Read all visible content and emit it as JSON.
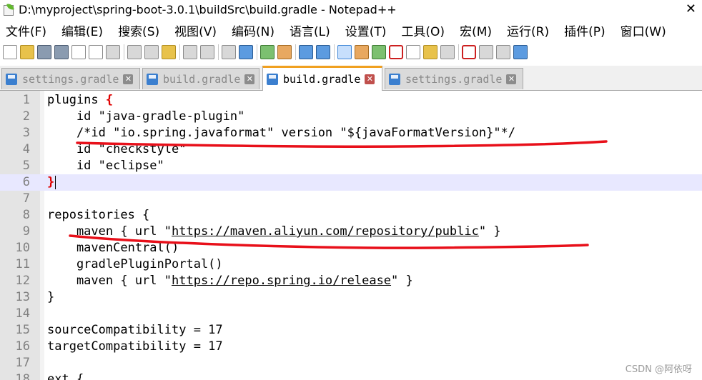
{
  "window": {
    "title": "D:\\myproject\\spring-boot-3.0.1\\buildSrc\\build.gradle - Notepad++",
    "close_glyph": "✕"
  },
  "menu": [
    "文件(F)",
    "编辑(E)",
    "搜索(S)",
    "视图(V)",
    "编码(N)",
    "语言(L)",
    "设置(T)",
    "工具(O)",
    "宏(M)",
    "运行(R)",
    "插件(P)",
    "窗口(W)"
  ],
  "toolbar": {
    "icons": [
      "new-file-icon",
      "open-file-icon",
      "save-icon",
      "save-all-icon",
      "close-icon",
      "close-all-icon",
      "print-icon",
      "cut-icon",
      "copy-icon",
      "paste-icon",
      "undo-icon",
      "redo-icon",
      "find-icon",
      "replace-icon",
      "zoom-in-icon",
      "zoom-out-icon",
      "sync-vertical-icon",
      "sync-horizontal-icon",
      "word-wrap-icon",
      "show-all-chars-icon",
      "indent-guide-icon",
      "document-map-icon",
      "function-list-icon",
      "folder-workspace-icon",
      "monitoring-icon",
      "record-macro-icon",
      "stop-record-icon",
      "play-macro-icon",
      "run-macro-multiple-icon"
    ]
  },
  "tabs": [
    {
      "label": "settings.gradle",
      "close": "✕",
      "active": false
    },
    {
      "label": "build.gradle",
      "close": "✕",
      "active": false
    },
    {
      "label": "build.gradle",
      "close": "✕",
      "active": true
    },
    {
      "label": "settings.gradle",
      "close": "✕",
      "active": false
    }
  ],
  "editor": {
    "lines": [
      {
        "num": "1",
        "segments": [
          {
            "text": "plugins "
          },
          {
            "text": "{",
            "style": "brace"
          }
        ]
      },
      {
        "num": "2",
        "segments": [
          {
            "text": "    id \"java-gradle-plugin\""
          }
        ]
      },
      {
        "num": "3",
        "segments": [
          {
            "text": "    /*id \"io.spring.javaformat\" version \"${javaFormatVersion}\"*/"
          }
        ]
      },
      {
        "num": "4",
        "segments": [
          {
            "text": "    id \"checkstyle\""
          }
        ]
      },
      {
        "num": "5",
        "segments": [
          {
            "text": "    id \"eclipse\""
          }
        ]
      },
      {
        "num": "6",
        "segments": [
          {
            "text": "}",
            "style": "brace"
          }
        ],
        "current": true
      },
      {
        "num": "7",
        "segments": []
      },
      {
        "num": "8",
        "segments": [
          {
            "text": "repositories {"
          }
        ]
      },
      {
        "num": "9",
        "segments": [
          {
            "text": "    maven { url \""
          },
          {
            "text": "https://maven.aliyun.com/repository/public",
            "style": "url"
          },
          {
            "text": "\" }"
          }
        ]
      },
      {
        "num": "10",
        "segments": [
          {
            "text": "    mavenCentral()"
          }
        ]
      },
      {
        "num": "11",
        "segments": [
          {
            "text": "    gradlePluginPortal()"
          }
        ]
      },
      {
        "num": "12",
        "segments": [
          {
            "text": "    maven { url \""
          },
          {
            "text": "https://repo.spring.io/release",
            "style": "url"
          },
          {
            "text": "\" }"
          }
        ]
      },
      {
        "num": "13",
        "segments": [
          {
            "text": "}"
          }
        ]
      },
      {
        "num": "14",
        "segments": []
      },
      {
        "num": "15",
        "segments": [
          {
            "text": "sourceCompatibility = 17"
          }
        ]
      },
      {
        "num": "16",
        "segments": [
          {
            "text": "targetCompatibility = 17"
          }
        ]
      },
      {
        "num": "17",
        "segments": []
      },
      {
        "num": "18",
        "segments": [
          {
            "text": "ext {"
          }
        ]
      }
    ]
  },
  "watermark": "CSDN @阿依呀",
  "colors": {
    "annotation": "#e8101a",
    "tab_accent": "#f0a020"
  }
}
